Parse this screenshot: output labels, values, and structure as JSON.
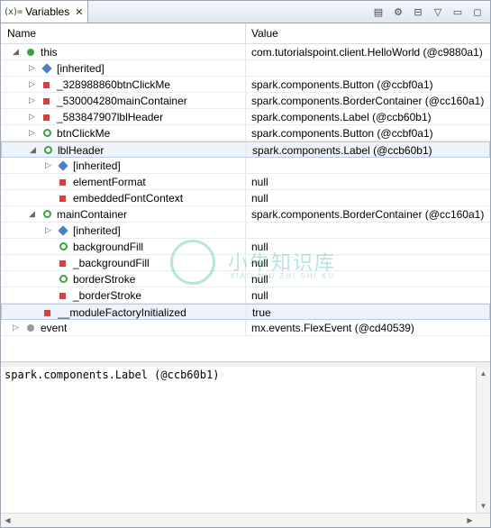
{
  "tab": {
    "icon": "(x)=",
    "title": "Variables",
    "close": "✕"
  },
  "toolbar": [
    {
      "name": "show-type-names-icon",
      "glyph": "▤"
    },
    {
      "name": "show-logical-structure-icon",
      "glyph": "⚙"
    },
    {
      "name": "collapse-all-icon",
      "glyph": "⊟"
    },
    {
      "name": "view-menu-icon",
      "glyph": "▽"
    },
    {
      "name": "minimize-icon",
      "glyph": "▭"
    },
    {
      "name": "maximize-icon",
      "glyph": "◻"
    }
  ],
  "columns": {
    "name": "Name",
    "value": "Value"
  },
  "rows": [
    {
      "indent": 0,
      "twisty": "◢",
      "icon": "dot",
      "name": "this",
      "value": "com.tutorialspoint.client.HelloWorld (@c9880a1)"
    },
    {
      "indent": 1,
      "twisty": "▷",
      "icon": "diamond",
      "name": "[inherited]",
      "value": ""
    },
    {
      "indent": 1,
      "twisty": "▷",
      "icon": "sq",
      "name": "_328988860btnClickMe",
      "value": "spark.components.Button (@ccbf0a1)"
    },
    {
      "indent": 1,
      "twisty": "▷",
      "icon": "sq",
      "name": "_530004280mainContainer",
      "value": "spark.components.BorderContainer (@cc160a1)"
    },
    {
      "indent": 1,
      "twisty": "▷",
      "icon": "sq",
      "name": "_583847907lblHeader",
      "value": "spark.components.Label (@ccb60b1)"
    },
    {
      "indent": 1,
      "twisty": "▷",
      "icon": "ring",
      "name": "btnClickMe",
      "value": "spark.components.Button (@ccbf0a1)"
    },
    {
      "indent": 1,
      "twisty": "◢",
      "icon": "ring",
      "name": "lblHeader",
      "value": "spark.components.Label (@ccb60b1)",
      "selected": true
    },
    {
      "indent": 2,
      "twisty": "▷",
      "icon": "diamond",
      "name": "[inherited]",
      "value": ""
    },
    {
      "indent": 2,
      "twisty": "",
      "icon": "sq",
      "name": "elementFormat",
      "value": "null"
    },
    {
      "indent": 2,
      "twisty": "",
      "icon": "sq",
      "name": "embeddedFontContext",
      "value": "null"
    },
    {
      "indent": 1,
      "twisty": "◢",
      "icon": "ring",
      "name": "mainContainer",
      "value": "spark.components.BorderContainer (@cc160a1)"
    },
    {
      "indent": 2,
      "twisty": "▷",
      "icon": "diamond",
      "name": "[inherited]",
      "value": ""
    },
    {
      "indent": 2,
      "twisty": "",
      "icon": "ring",
      "name": "backgroundFill",
      "value": "null"
    },
    {
      "indent": 2,
      "twisty": "",
      "icon": "sq",
      "name": "_backgroundFill",
      "value": "null"
    },
    {
      "indent": 2,
      "twisty": "",
      "icon": "ring",
      "name": "borderStroke",
      "value": "null"
    },
    {
      "indent": 2,
      "twisty": "",
      "icon": "sq",
      "name": "_borderStroke",
      "value": "null"
    },
    {
      "indent": 1,
      "twisty": "",
      "icon": "sq",
      "name": "__moduleFactoryInitialized",
      "value": "true",
      "selected": true
    },
    {
      "indent": 0,
      "twisty": "▷",
      "icon": "gray",
      "name": "event",
      "value": "mx.events.FlexEvent (@cd40539)"
    }
  ],
  "detail": {
    "text": "spark.components.Label (@ccb60b1)"
  },
  "watermark": {
    "text": "小牛知识库",
    "sub": "XIAO NIU ZHI SHI KU"
  }
}
